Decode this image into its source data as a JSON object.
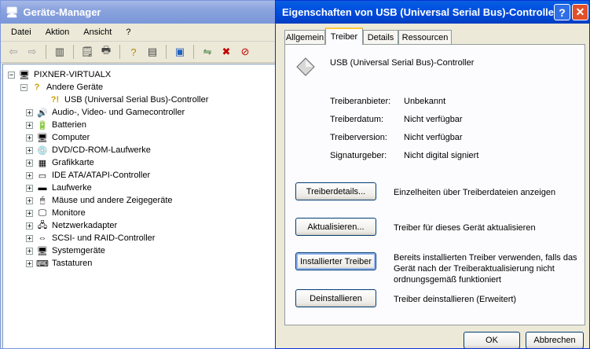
{
  "devmgr": {
    "title": "Geräte-Manager",
    "menu": [
      "Datei",
      "Aktion",
      "Ansicht",
      "?"
    ],
    "tree": {
      "root": "PIXNER-VIRTUALX",
      "other_group": "Andere Geräte",
      "usb_child": "USB (Universal Serial Bus)-Controller",
      "categories": [
        "Audio-, Video- und Gamecontroller",
        "Batterien",
        "Computer",
        "DVD/CD-ROM-Laufwerke",
        "Grafikkarte",
        "IDE ATA/ATAPI-Controller",
        "Laufwerke",
        "Mäuse und andere Zeigegeräte",
        "Monitore",
        "Netzwerkadapter",
        "SCSI- und RAID-Controller",
        "Systemgeräte",
        "Tastaturen"
      ]
    }
  },
  "props": {
    "title": "Eigenschaften von USB (Universal Serial Bus)-Controller",
    "help": "?",
    "close": "✕",
    "tabs": [
      "Allgemein",
      "Treiber",
      "Details",
      "Ressourcen"
    ],
    "device_name": "USB (Universal Serial Bus)-Controller",
    "info": [
      {
        "label": "Treiberanbieter:",
        "value": "Unbekannt"
      },
      {
        "label": "Treiberdatum:",
        "value": "Nicht verfügbar"
      },
      {
        "label": "Treiberversion:",
        "value": "Nicht verfügbar"
      },
      {
        "label": "Signaturgeber:",
        "value": "Nicht digital signiert"
      }
    ],
    "actions": [
      {
        "button": "Treiberdetails...",
        "desc": [
          "Einzelheiten über Treiberdateien anzeigen"
        ]
      },
      {
        "button": "Aktualisieren...",
        "desc": [
          "Treiber für dieses Gerät aktualisieren"
        ]
      },
      {
        "button": "Installierter Treiber",
        "desc": [
          "Bereits installierten Treiber verwenden, falls das",
          "Gerät nach der Treiberaktualisierung nicht",
          "ordnungsgemäß funktioniert"
        ]
      },
      {
        "button": "Deinstallieren",
        "desc": [
          "Treiber deinstallieren (Erweitert)"
        ]
      }
    ],
    "ok": "OK",
    "cancel": "Abbrechen"
  }
}
